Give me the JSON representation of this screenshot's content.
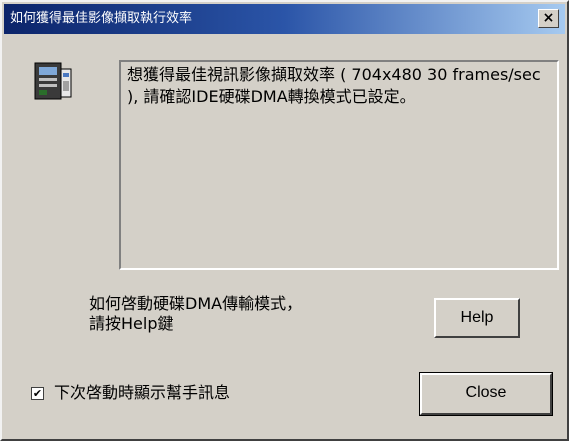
{
  "window": {
    "title": "如何獲得最佳影像擷取執行效率",
    "close_symbol": "×"
  },
  "message": {
    "text": "想獲得最佳視訊影像擷取效率 ( 704x480 30 frames/sec ), 請確認IDE硬碟DMA轉換模式已設定。"
  },
  "hint": {
    "line1": "如何啓動硬碟DMA傳輸模式，",
    "line2": "請按Help鍵"
  },
  "buttons": {
    "help_label": "Help",
    "close_label": "Close"
  },
  "checkbox": {
    "checked": true,
    "mark": "✔",
    "label": "下次啓動時顯示幫手訊息"
  },
  "icon": {
    "name": "computer-icon"
  }
}
